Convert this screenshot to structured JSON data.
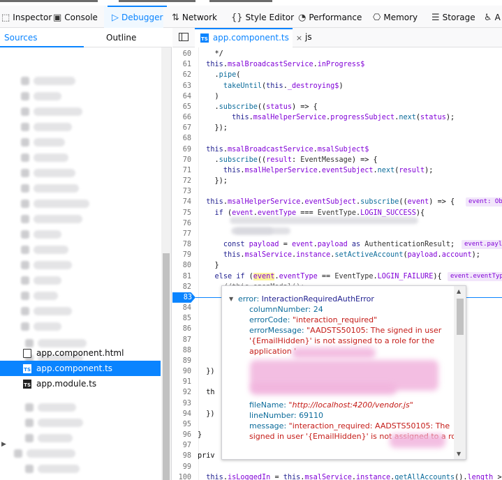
{
  "toolbar": {
    "tabs": [
      {
        "label": "Inspector",
        "icon": "inspector-icon",
        "glyph": "⬚"
      },
      {
        "label": "Console",
        "icon": "console-icon",
        "glyph": "▣"
      },
      {
        "label": "Debugger",
        "icon": "debugger-icon",
        "glyph": "▷"
      },
      {
        "label": "Network",
        "icon": "network-icon",
        "glyph": "⇅"
      },
      {
        "label": "Style Editor",
        "icon": "style-editor-icon",
        "glyph": "{}"
      },
      {
        "label": "Performance",
        "icon": "performance-icon",
        "glyph": "◔"
      },
      {
        "label": "Memory",
        "icon": "memory-icon",
        "glyph": "⎔"
      },
      {
        "label": "Storage",
        "icon": "storage-icon",
        "glyph": "☰"
      },
      {
        "label": "A",
        "icon": "accessibility-icon",
        "glyph": "♿"
      }
    ],
    "active": "Debugger",
    "accent": "#0a84ff"
  },
  "left_panel": {
    "tabs": [
      "Sources",
      "Outline"
    ],
    "files": [
      {
        "name": "app.component.html",
        "type": "html",
        "selected": false
      },
      {
        "name": "app.component.ts",
        "type": "ts",
        "selected": true
      },
      {
        "name": "app.module.ts",
        "type": "ts",
        "selected": false
      }
    ]
  },
  "editor": {
    "tabs": [
      {
        "label": "app.component.ts",
        "badge": "TS",
        "close": "×",
        "active": true
      },
      {
        "label": "js",
        "active": false
      }
    ],
    "paused_line": "83",
    "lines": [
      {
        "n": "60",
        "html": "    */"
      },
      {
        "n": "61",
        "html": "  <span class='kw'>this</span>.<span class='pp'>msalBroadcastService</span>.<span class='pp'>inProgress$</span>"
      },
      {
        "n": "62",
        "html": "    .<span class='fn'>pipe</span>("
      },
      {
        "n": "63",
        "html": "      <span class='fn'>takeUntil</span>(<span class='kw'>this</span>.<span class='pp'>_destroying$</span>)"
      },
      {
        "n": "64",
        "html": "    )"
      },
      {
        "n": "65",
        "html": "    .<span class='fn'>subscribe</span>((<span class='pp'>status</span>) => {"
      },
      {
        "n": "66",
        "html": "        <span class='kw'>this</span>.<span class='pp'>msalHelperService</span>.<span class='pp'>progressSubject</span>.<span class='fn'>next</span>(<span class='pp'>status</span>);"
      },
      {
        "n": "67",
        "html": "    });"
      },
      {
        "n": "68",
        "html": ""
      },
      {
        "n": "69",
        "html": "  <span class='kw'>this</span>.<span class='pp'>msalBroadcastService</span>.<span class='pp'>msalSubject$</span>"
      },
      {
        "n": "70",
        "html": "    .<span class='fn'>subscribe</span>((<span class='pp'>result</span>: <span class='tp'>EventMessage</span>) => {"
      },
      {
        "n": "71",
        "html": "      <span class='kw'>this</span>.<span class='pp'>msalHelperService</span>.<span class='pp'>eventSubject</span>.<span class='fn'>next</span>(<span class='pp'>result</span>);"
      },
      {
        "n": "72",
        "html": "    });"
      },
      {
        "n": "73",
        "html": ""
      },
      {
        "n": "74",
        "html": "  <span class='kw'>this</span>.<span class='pp'>msalHelperService</span>.<span class='pp'>eventSubject</span>.<span class='fn'>subscribe</span>((<span class='pp'>event</span>) => {"
      },
      {
        "n": "75",
        "html": "    <span class='kw'>if</span> (<span class='pp'>event</span>.<span class='pp'>eventType</span> === <span class='tp'>EventType</span>.<span class='pp'>LOGIN_SUCCESS</span>){"
      },
      {
        "n": "76",
        "html": ""
      },
      {
        "n": "77",
        "html": ""
      },
      {
        "n": "78",
        "html": "      <span class='kw'>const</span> <span class='pp'>payload</span> = <span class='pp'>event</span>.<span class='pp'>payload</span> <span class='kw'>as</span> <span class='tp'>AuthenticationResult</span>;"
      },
      {
        "n": "79",
        "html": "      <span class='kw'>this</span>.<span class='pp'>msalService</span>.<span class='pp'>instance</span>.<span class='fn'>setActiveAccount</span>(<span class='pp'>payload</span>.<span class='pp'>account</span>);"
      },
      {
        "n": "80",
        "html": "    }"
      },
      {
        "n": "81",
        "html": "    <span class='kw'>else if</span> (<span class='hl'><span class='pp'>event</span></span>.<span class='pp'>eventType</span> == <span class='tp'>EventType</span>.<span class='pp'>LOGIN_FAILURE</span>){"
      },
      {
        "n": "82",
        "html": "      <span class='cm'>//this.openModal();</span>"
      },
      {
        "n": "83",
        "html": ""
      },
      {
        "n": "84",
        "html": ""
      },
      {
        "n": "85",
        "html": ""
      },
      {
        "n": "86",
        "html": ""
      },
      {
        "n": "87",
        "html": ""
      },
      {
        "n": "88",
        "html": ""
      },
      {
        "n": "89",
        "html": ""
      },
      {
        "n": "90",
        "html": "  })"
      },
      {
        "n": "91",
        "html": ""
      },
      {
        "n": "92",
        "html": "  th                                              => {"
      },
      {
        "n": "93",
        "html": ""
      },
      {
        "n": "94",
        "html": "  })"
      },
      {
        "n": "95",
        "html": ""
      },
      {
        "n": "96",
        "html": "}"
      },
      {
        "n": "97",
        "html": ""
      },
      {
        "n": "98",
        "html": "priv"
      },
      {
        "n": "99",
        "html": ""
      },
      {
        "n": "100",
        "html": "  <span class='kw'>this</span>.<span class='pp'>isLoggedIn</span> = <span class='kw'>this</span>.<span class='pp'>msalService</span>.<span class='pp'>instance</span>.<span class='fn'>getAllAccounts</span>().<span class='pp'>length</span> >"
      }
    ],
    "inline_previews": [
      {
        "line": "74",
        "text": "event: Ob"
      },
      {
        "line": "78",
        "text": "event.paylo"
      },
      {
        "line": "81",
        "text": "event.eventTyp"
      }
    ]
  },
  "popup": {
    "header_key": "error",
    "header_value": "InteractionRequiredAuthError",
    "props": [
      {
        "key": "columnNumber",
        "value": "24",
        "kind": "num"
      },
      {
        "key": "errorCode",
        "value": "\"interaction_required\"",
        "kind": "str"
      },
      {
        "key": "errorMessage",
        "value": "\"AADSTS50105: The signed in user",
        "kind": "str"
      },
      {
        "key": "",
        "value": "'{EmailHidden}' is not assigned to a role for the",
        "kind": "str"
      },
      {
        "key": "",
        "value": "application '",
        "kind": "str"
      },
      {
        "key": "fileName",
        "value": "\"http://localhost:4200/vendor.js\"",
        "kind": "italic"
      },
      {
        "key": "lineNumber",
        "value": "69110",
        "kind": "num"
      },
      {
        "key": "message",
        "value": "\"interaction_required: AADSTS50105: The",
        "kind": "str"
      },
      {
        "key": "",
        "value": "signed in user '{EmailHidden}' is not assigned to a role",
        "kind": "str"
      }
    ]
  }
}
